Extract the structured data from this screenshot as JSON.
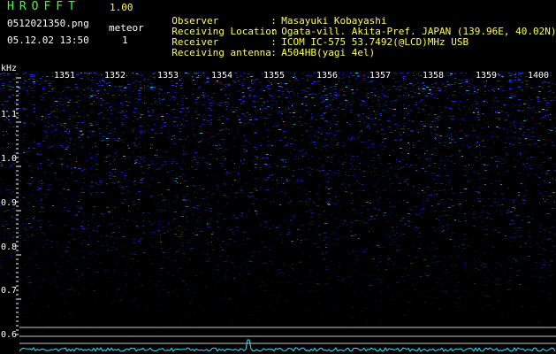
{
  "header": {
    "app_title": "HROFFT",
    "version": "1.00",
    "file_name": "0512021350.png",
    "date_time": "05.12.02 13:50",
    "meteor_label": "meteor",
    "meteor_count": "1"
  },
  "info": [
    {
      "key": "Observer",
      "sep": ":",
      "value": "Masayuki Kobayashi"
    },
    {
      "key": "Receiving Location",
      "sep": ":",
      "value": "Ogata-vill. Akita-Pref. JAPAN (139.96E, 40.02N)"
    },
    {
      "key": "Receiver",
      "sep": ":",
      "value": "ICOM IC-575 53.7492(@LCD)MHz USB"
    },
    {
      "key": "Receiving antenna",
      "sep": ":",
      "value": "A504HB(yagi 4el)"
    }
  ],
  "axis": {
    "unit": "kHz",
    "freq_labels": [
      "1.1",
      "1.0",
      "0.9",
      "0.8",
      "0.7",
      "0.6"
    ],
    "time_labels": [
      "1351",
      "1352",
      "1353",
      "1354",
      "1355",
      "1356",
      "1357",
      "1358",
      "1359",
      "1400"
    ]
  },
  "colors": {
    "background": "#000000",
    "header_green": "#3dff3d",
    "header_yellow": "#ffff40",
    "spectrum_blue": "#1a3cff",
    "spectrum_cyan": "#34e0ff"
  }
}
